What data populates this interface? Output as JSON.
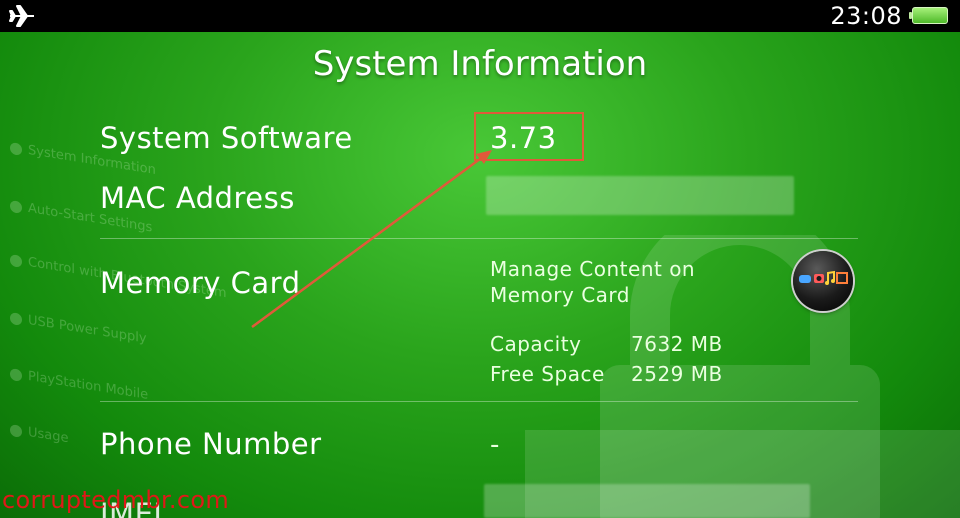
{
  "status_bar": {
    "clock": "23:08",
    "airplane_icon": "airplane-icon",
    "battery_icon": "battery-icon"
  },
  "page": {
    "title": "System Information"
  },
  "background_sidebar": {
    "items": [
      "System Information",
      "Auto-Start Settings",
      "Control with Bluetooth System",
      "USB Power Supply",
      "PlayStation Mobile",
      "Usage"
    ]
  },
  "rows": {
    "system_software": {
      "label": "System Software",
      "value": "3.73"
    },
    "mac_address": {
      "label": "MAC Address",
      "value": ""
    },
    "memory_card": {
      "label": "Memory Card",
      "manage_text": "Manage Content on Memory Card",
      "capacity_label": "Capacity",
      "capacity_value": "7632 MB",
      "free_space_label": "Free Space",
      "free_space_value": "2529 MB",
      "icon": "content-manager-icon"
    },
    "phone_number": {
      "label": "Phone Number",
      "value": "-"
    },
    "imei": {
      "label": "IMEI",
      "value": ""
    }
  },
  "annotation": {
    "highlight_color": "#e05a3a"
  },
  "watermark": "corruptedmbr.com",
  "colors": {
    "background": "#2aa41c",
    "status_bar": "#000000",
    "watermark": "#e01818"
  }
}
